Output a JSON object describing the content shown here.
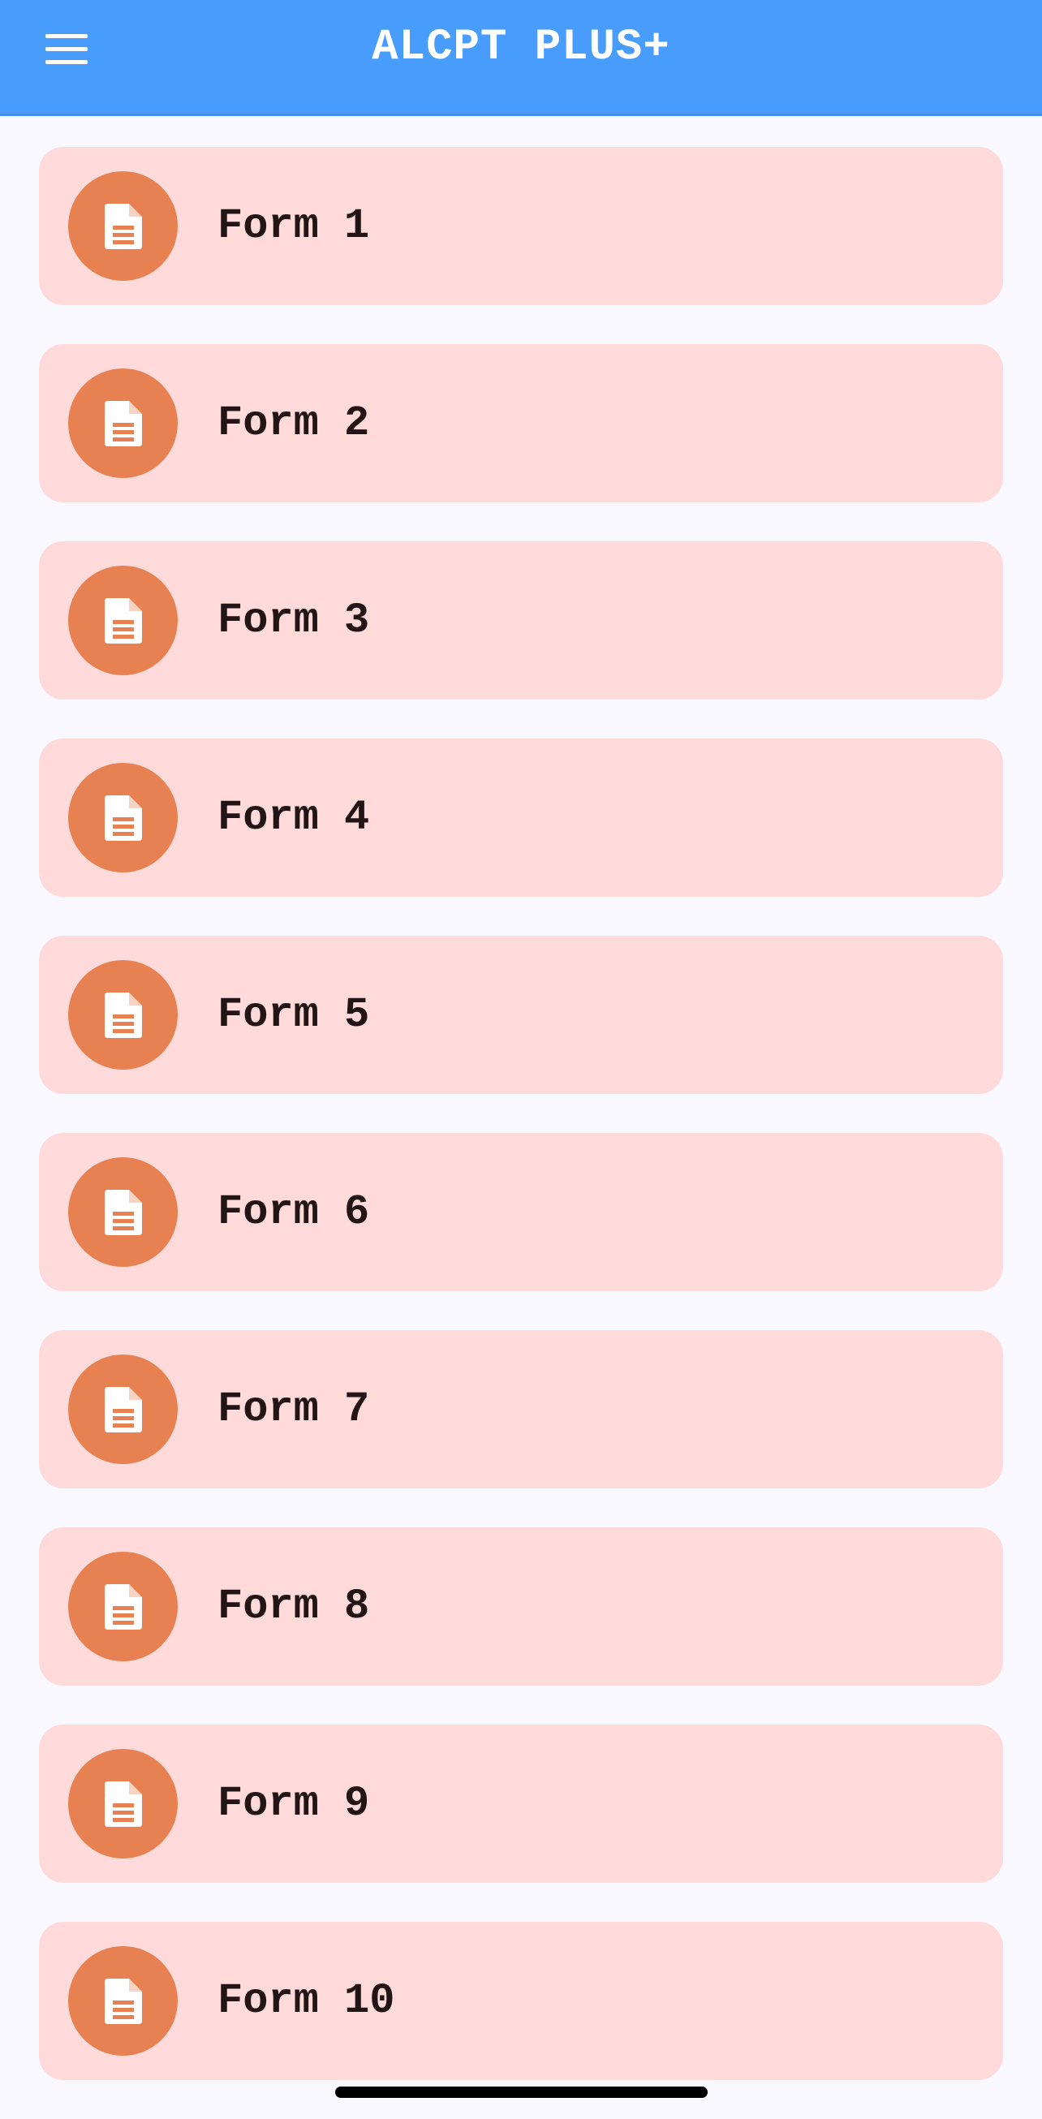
{
  "app_bar": {
    "title": "ALCPT PLUS+",
    "background_color": "#479cfc",
    "menu_icon": "hamburger-menu-icon"
  },
  "form_list": {
    "item_background_color": "#fedbda",
    "icon_background_color": "#e88152",
    "icon": "document-icon",
    "items": [
      {
        "label": "Form 1"
      },
      {
        "label": "Form 2"
      },
      {
        "label": "Form 3"
      },
      {
        "label": "Form 4"
      },
      {
        "label": "Form 5"
      },
      {
        "label": "Form 6"
      },
      {
        "label": "Form 7"
      },
      {
        "label": "Form 8"
      },
      {
        "label": "Form 9"
      },
      {
        "label": "Form 10"
      }
    ]
  }
}
